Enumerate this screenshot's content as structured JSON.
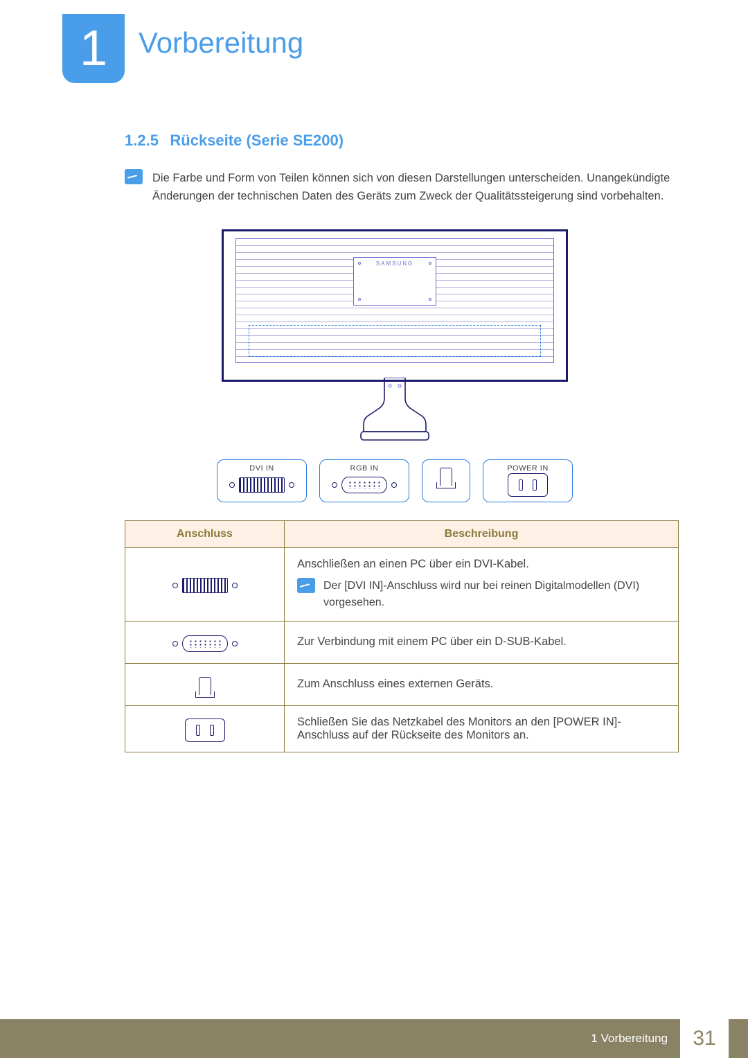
{
  "chapter": {
    "number": "1",
    "title": "Vorbereitung"
  },
  "section": {
    "number": "1.2.5",
    "title": "Rückseite (Serie SE200)"
  },
  "intro_note": "Die Farbe und Form von Teilen können sich von diesen Darstellungen unterscheiden. Unangekündigte Änderungen der technischen Daten des Geräts zum Zweck der Qualitätssteigerung sind vorbehalten.",
  "diagram": {
    "brand": "SAMSUNG",
    "ports": [
      {
        "label": "DVI IN"
      },
      {
        "label": "RGB IN"
      },
      {
        "label": ""
      },
      {
        "label": "POWER IN"
      }
    ]
  },
  "table": {
    "headers": {
      "col1": "Anschluss",
      "col2": "Beschreibung"
    },
    "rows": [
      {
        "desc": "Anschließen an einen PC über ein DVI-Kabel.",
        "sub_note": "Der [DVI IN]-Anschluss wird nur bei reinen Digitalmodellen (DVI) vorgesehen."
      },
      {
        "desc": "Zur Verbindung mit einem PC über ein D-SUB-Kabel."
      },
      {
        "desc": "Zum Anschluss eines externen Geräts."
      },
      {
        "desc": "Schließen Sie das Netzkabel des Monitors an den [POWER IN]-Anschluss auf der Rückseite des Monitors an."
      }
    ]
  },
  "footer": {
    "breadcrumb": "1 Vorbereitung",
    "page": "31"
  }
}
